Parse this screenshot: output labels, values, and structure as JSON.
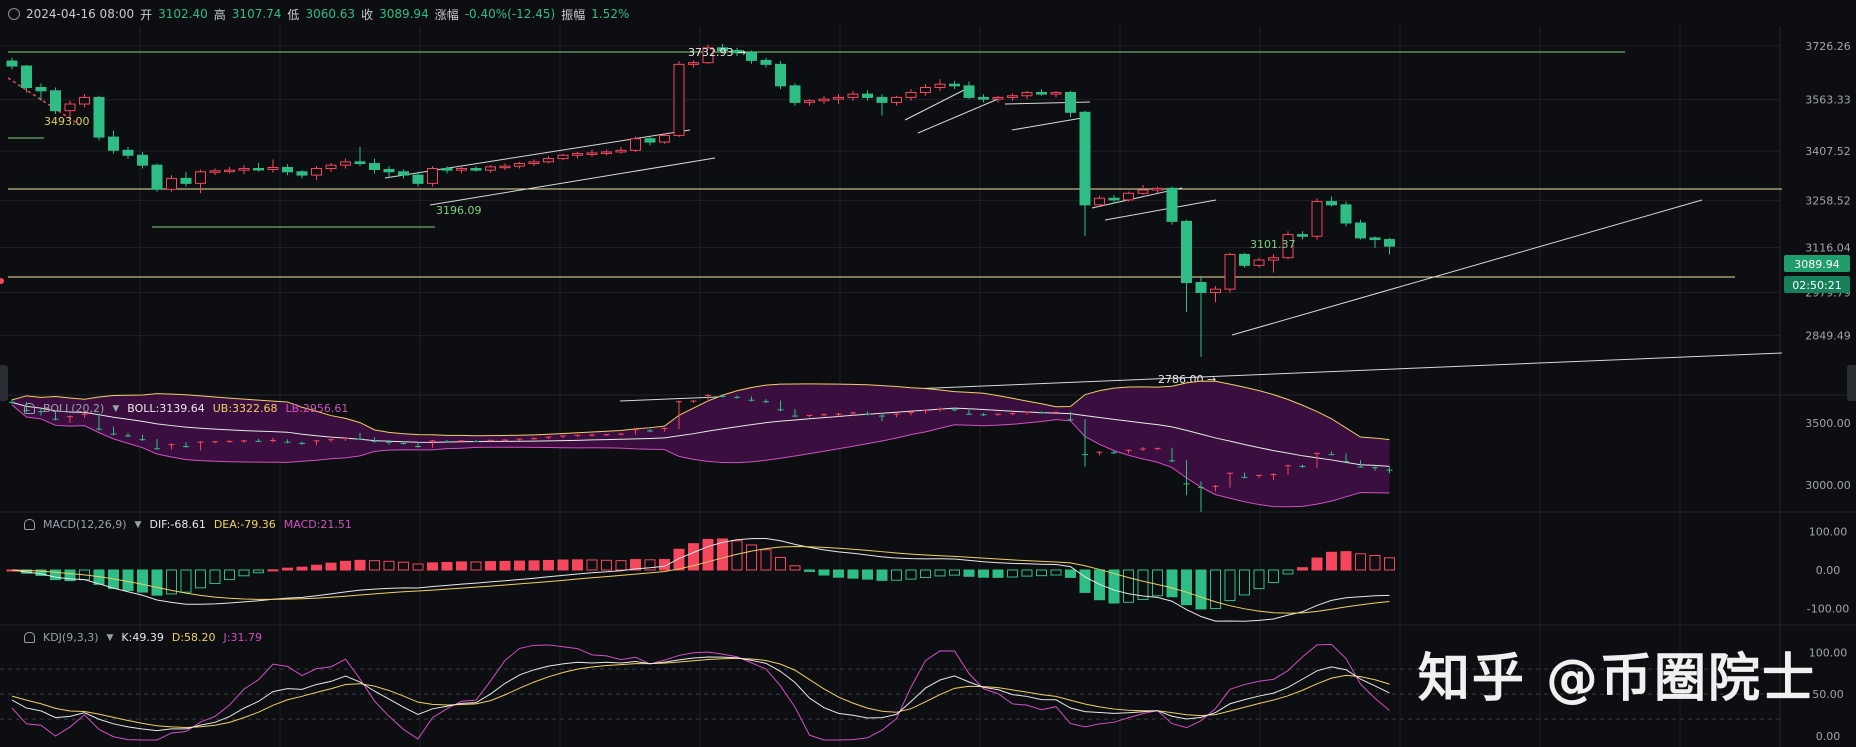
{
  "header": {
    "date": "2024-04-16 08:00",
    "open_label": "开",
    "open": "3102.40",
    "high_label": "高",
    "high": "3107.74",
    "low_label": "低",
    "low": "3060.63",
    "close_label": "收",
    "close": "3089.94",
    "change_label": "涨幅",
    "change": "-0.40%(-12.45)",
    "amplitude_label": "振幅",
    "amplitude": "1.52%"
  },
  "price_axis": {
    "ticks": [
      {
        "v": 3726.26,
        "label": "3726.26"
      },
      {
        "v": 3563.33,
        "label": "3563.33"
      },
      {
        "v": 3407.52,
        "label": "3407.52"
      },
      {
        "v": 3258.52,
        "label": "3258.52"
      },
      {
        "v": 3116.04,
        "label": "3116.04"
      },
      {
        "v": 2979.79,
        "label": "2979.79"
      },
      {
        "v": 2849.49,
        "label": "2849.49"
      }
    ],
    "current_price": "3089.94",
    "countdown": "02:50:21"
  },
  "annotations": {
    "high_mark": "3732.93",
    "low_mark": "2786.00",
    "left_mark": "3493.00",
    "mark_3196": "3196.09",
    "mark_3101": "3101.37"
  },
  "boll": {
    "name": "BOLL(20,2)",
    "boll": "BOLL:3139.64",
    "ub": "UB:3322.68",
    "lb": "LB:2956.61",
    "ticks": [
      "3500.00",
      "3000.00"
    ]
  },
  "macd": {
    "name": "MACD(12,26,9)",
    "dif": "DIF:-68.61",
    "dea": "DEA:-79.36",
    "macd": "MACD:21.51",
    "ticks": [
      "100.00",
      "0.00",
      "-100.00"
    ]
  },
  "kdj": {
    "name": "KDJ(9,3,3)",
    "k": "K:49.39",
    "d": "D:58.20",
    "j": "J:31.79",
    "ticks": [
      "100.00",
      "50.00",
      "0.00"
    ]
  },
  "watermark": "知乎 @币圈院士",
  "colors": {
    "up": "#f6465d",
    "down": "#2ebd85",
    "bg": "#0d0e12",
    "grid": "#1e2026",
    "hline_yellow": "#f0e0a0",
    "hline_green": "#7fd07f",
    "boll_fill": "#3a0e3e",
    "label_green_bg": "#1f9d6a"
  },
  "chart_data": {
    "type": "candlestick",
    "candles": [
      {
        "o": 3680,
        "h": 3690,
        "l": 3655,
        "c": 3665
      },
      {
        "o": 3665,
        "h": 3668,
        "l": 3585,
        "c": 3600
      },
      {
        "o": 3600,
        "h": 3612,
        "l": 3560,
        "c": 3590
      },
      {
        "o": 3590,
        "h": 3600,
        "l": 3520,
        "c": 3530
      },
      {
        "o": 3530,
        "h": 3560,
        "l": 3500,
        "c": 3550
      },
      {
        "o": 3550,
        "h": 3580,
        "l": 3540,
        "c": 3570
      },
      {
        "o": 3570,
        "h": 3575,
        "l": 3440,
        "c": 3450
      },
      {
        "o": 3450,
        "h": 3470,
        "l": 3400,
        "c": 3410
      },
      {
        "o": 3410,
        "h": 3420,
        "l": 3385,
        "c": 3395
      },
      {
        "o": 3395,
        "h": 3405,
        "l": 3355,
        "c": 3365
      },
      {
        "o": 3365,
        "h": 3370,
        "l": 3285,
        "c": 3292
      },
      {
        "o": 3292,
        "h": 3335,
        "l": 3285,
        "c": 3325
      },
      {
        "o": 3325,
        "h": 3345,
        "l": 3300,
        "c": 3310
      },
      {
        "o": 3310,
        "h": 3352,
        "l": 3280,
        "c": 3345
      },
      {
        "o": 3345,
        "h": 3355,
        "l": 3335,
        "c": 3348
      },
      {
        "o": 3348,
        "h": 3360,
        "l": 3340,
        "c": 3350
      },
      {
        "o": 3350,
        "h": 3365,
        "l": 3338,
        "c": 3355
      },
      {
        "o": 3355,
        "h": 3372,
        "l": 3345,
        "c": 3352
      },
      {
        "o": 3352,
        "h": 3382,
        "l": 3342,
        "c": 3358
      },
      {
        "o": 3358,
        "h": 3368,
        "l": 3335,
        "c": 3345
      },
      {
        "o": 3345,
        "h": 3350,
        "l": 3325,
        "c": 3335
      },
      {
        "o": 3335,
        "h": 3362,
        "l": 3320,
        "c": 3355
      },
      {
        "o": 3355,
        "h": 3372,
        "l": 3345,
        "c": 3365
      },
      {
        "o": 3365,
        "h": 3385,
        "l": 3355,
        "c": 3375
      },
      {
        "o": 3375,
        "h": 3420,
        "l": 3362,
        "c": 3370
      },
      {
        "o": 3370,
        "h": 3385,
        "l": 3340,
        "c": 3352
      },
      {
        "o": 3352,
        "h": 3362,
        "l": 3325,
        "c": 3345
      },
      {
        "o": 3345,
        "h": 3352,
        "l": 3325,
        "c": 3335
      },
      {
        "o": 3335,
        "h": 3345,
        "l": 3300,
        "c": 3310
      },
      {
        "o": 3310,
        "h": 3362,
        "l": 3300,
        "c": 3355
      },
      {
        "o": 3355,
        "h": 3362,
        "l": 3340,
        "c": 3350
      },
      {
        "o": 3350,
        "h": 3360,
        "l": 3340,
        "c": 3355
      },
      {
        "o": 3355,
        "h": 3362,
        "l": 3345,
        "c": 3350
      },
      {
        "o": 3350,
        "h": 3365,
        "l": 3342,
        "c": 3360
      },
      {
        "o": 3360,
        "h": 3370,
        "l": 3350,
        "c": 3362
      },
      {
        "o": 3362,
        "h": 3375,
        "l": 3355,
        "c": 3370
      },
      {
        "o": 3370,
        "h": 3382,
        "l": 3362,
        "c": 3375
      },
      {
        "o": 3375,
        "h": 3392,
        "l": 3370,
        "c": 3385
      },
      {
        "o": 3385,
        "h": 3400,
        "l": 3380,
        "c": 3395
      },
      {
        "o": 3395,
        "h": 3405,
        "l": 3385,
        "c": 3400
      },
      {
        "o": 3400,
        "h": 3412,
        "l": 3390,
        "c": 3402
      },
      {
        "o": 3402,
        "h": 3412,
        "l": 3395,
        "c": 3405
      },
      {
        "o": 3405,
        "h": 3420,
        "l": 3400,
        "c": 3410
      },
      {
        "o": 3410,
        "h": 3452,
        "l": 3405,
        "c": 3445
      },
      {
        "o": 3445,
        "h": 3452,
        "l": 3425,
        "c": 3435
      },
      {
        "o": 3435,
        "h": 3462,
        "l": 3430,
        "c": 3455
      },
      {
        "o": 3455,
        "h": 3680,
        "l": 3450,
        "c": 3670
      },
      {
        "o": 3670,
        "h": 3682,
        "l": 3660,
        "c": 3675
      },
      {
        "o": 3675,
        "h": 3730,
        "l": 3672,
        "c": 3720
      },
      {
        "o": 3720,
        "h": 3732,
        "l": 3705,
        "c": 3712
      },
      {
        "o": 3712,
        "h": 3720,
        "l": 3695,
        "c": 3705
      },
      {
        "o": 3705,
        "h": 3712,
        "l": 3672,
        "c": 3682
      },
      {
        "o": 3682,
        "h": 3690,
        "l": 3660,
        "c": 3670
      },
      {
        "o": 3670,
        "h": 3680,
        "l": 3595,
        "c": 3605
      },
      {
        "o": 3605,
        "h": 3612,
        "l": 3545,
        "c": 3555
      },
      {
        "o": 3555,
        "h": 3565,
        "l": 3545,
        "c": 3560
      },
      {
        "o": 3560,
        "h": 3575,
        "l": 3550,
        "c": 3565
      },
      {
        "o": 3565,
        "h": 3580,
        "l": 3550,
        "c": 3570
      },
      {
        "o": 3570,
        "h": 3590,
        "l": 3560,
        "c": 3580
      },
      {
        "o": 3580,
        "h": 3592,
        "l": 3560,
        "c": 3570
      },
      {
        "o": 3570,
        "h": 3580,
        "l": 3515,
        "c": 3555
      },
      {
        "o": 3555,
        "h": 3575,
        "l": 3545,
        "c": 3570
      },
      {
        "o": 3570,
        "h": 3595,
        "l": 3560,
        "c": 3585
      },
      {
        "o": 3585,
        "h": 3610,
        "l": 3575,
        "c": 3600
      },
      {
        "o": 3600,
        "h": 3625,
        "l": 3590,
        "c": 3610
      },
      {
        "o": 3610,
        "h": 3620,
        "l": 3595,
        "c": 3605
      },
      {
        "o": 3605,
        "h": 3618,
        "l": 3565,
        "c": 3570
      },
      {
        "o": 3570,
        "h": 3580,
        "l": 3555,
        "c": 3565
      },
      {
        "o": 3565,
        "h": 3575,
        "l": 3555,
        "c": 3570
      },
      {
        "o": 3570,
        "h": 3582,
        "l": 3560,
        "c": 3575
      },
      {
        "o": 3575,
        "h": 3590,
        "l": 3565,
        "c": 3585
      },
      {
        "o": 3585,
        "h": 3595,
        "l": 3575,
        "c": 3580
      },
      {
        "o": 3580,
        "h": 3590,
        "l": 3570,
        "c": 3585
      },
      {
        "o": 3585,
        "h": 3590,
        "l": 3510,
        "c": 3525
      },
      {
        "o": 3525,
        "h": 3530,
        "l": 3150,
        "c": 3245
      },
      {
        "o": 3245,
        "h": 3272,
        "l": 3240,
        "c": 3265
      },
      {
        "o": 3265,
        "h": 3275,
        "l": 3250,
        "c": 3260
      },
      {
        "o": 3260,
        "h": 3285,
        "l": 3255,
        "c": 3280
      },
      {
        "o": 3280,
        "h": 3305,
        "l": 3275,
        "c": 3290
      },
      {
        "o": 3290,
        "h": 3300,
        "l": 3280,
        "c": 3295
      },
      {
        "o": 3295,
        "h": 3300,
        "l": 3185,
        "c": 3195
      },
      {
        "o": 3195,
        "h": 3200,
        "l": 2920,
        "c": 3010
      },
      {
        "o": 3010,
        "h": 3030,
        "l": 2785,
        "c": 2980
      },
      {
        "o": 2980,
        "h": 3000,
        "l": 2950,
        "c": 2990
      },
      {
        "o": 2990,
        "h": 3100,
        "l": 2980,
        "c": 3095
      },
      {
        "o": 3095,
        "h": 3100,
        "l": 3055,
        "c": 3062
      },
      {
        "o": 3062,
        "h": 3085,
        "l": 3055,
        "c": 3078
      },
      {
        "o": 3078,
        "h": 3095,
        "l": 3040,
        "c": 3085
      },
      {
        "o": 3085,
        "h": 3165,
        "l": 3080,
        "c": 3155
      },
      {
        "o": 3155,
        "h": 3165,
        "l": 3140,
        "c": 3150
      },
      {
        "o": 3150,
        "h": 3265,
        "l": 3140,
        "c": 3255
      },
      {
        "o": 3255,
        "h": 3270,
        "l": 3240,
        "c": 3245
      },
      {
        "o": 3245,
        "h": 3255,
        "l": 3180,
        "c": 3190
      },
      {
        "o": 3190,
        "h": 3200,
        "l": 3140,
        "c": 3145
      },
      {
        "o": 3145,
        "h": 3150,
        "l": 3115,
        "c": 3140
      },
      {
        "o": 3140,
        "h": 3145,
        "l": 3095,
        "c": 3120
      }
    ]
  }
}
